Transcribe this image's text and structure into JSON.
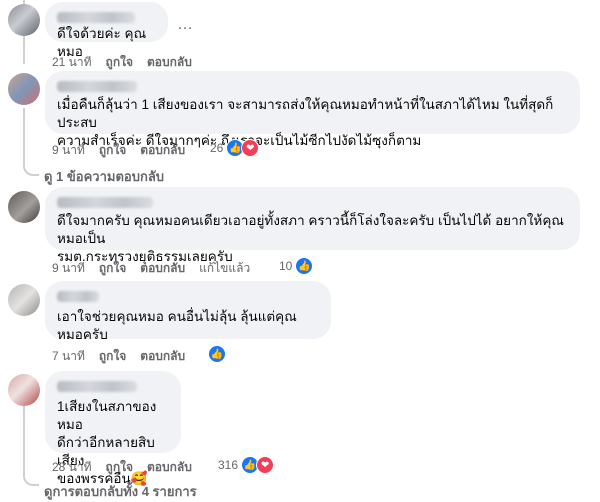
{
  "comments": [
    {
      "text": "ดีใจด้วยค่ะ คุณหมอ",
      "time": "21 นาที",
      "like_label": "ถูกใจ",
      "reply_label": "ตอบกลับ",
      "more": "…"
    },
    {
      "text": "เมื่อคืนก็ลุ้นว่า 1 เสียงของเรา จะสามารถส่งให้คุณหมอทำหน้าที่ในสภาได้ไหม ในที่สุดก็ประสบ\nความสำเร็จค่ะ ดีใจมากๆค่ะ ถึงเราจะเป็นไม้ซีกไปงัดไม้ซุงก็ตาม",
      "time": "9 นาที",
      "like_label": "ถูกใจ",
      "reply_label": "ตอบกลับ",
      "reaction_count": "26",
      "reactions": [
        "like-icon",
        "love-icon"
      ]
    },
    {
      "text": "ดีใจมากครับ คุณหมอคนเดียวเอาอยู่ทั้งสภา คราวนี้ก็โล่งใจละครับ เป็นไปได้ อยากให้คุณหมอเป็น\nรมต.กระทรวงยุติธรรมเลยครับ",
      "time": "9 นาที",
      "like_label": "ถูกใจ",
      "reply_label": "ตอบกลับ",
      "edited_label": "แก้ไขแล้ว",
      "reaction_count": "10",
      "reactions": [
        "like-icon"
      ]
    },
    {
      "text": "เอาใจช่วยคุณหมอ คนอื่นไม่ลุ้น ลุ้นแต่คุณหมอครับ",
      "time": "7 นาที",
      "like_label": "ถูกใจ",
      "reply_label": "ตอบกลับ",
      "reactions": [
        "like-icon"
      ]
    },
    {
      "text": "1เสียงในสภาของหมอ\nดีกว่าอีกหลายสิบเสียง\nของพรรคอื่น🥰",
      "time": "28 นาที",
      "like_label": "ถูกใจ",
      "reply_label": "ตอบกลับ",
      "reaction_count": "316",
      "reactions": [
        "like-icon",
        "love-icon"
      ]
    }
  ],
  "view_replies_1": "ดู 1 ข้อความตอบกลับ",
  "view_replies_all": "ดูการตอบกลับทั้ง 4 รายการ",
  "colors": {
    "like": "#1877f2",
    "love": "#f33e58",
    "bubble": "#f0f2f5",
    "meta": "#65676b"
  }
}
